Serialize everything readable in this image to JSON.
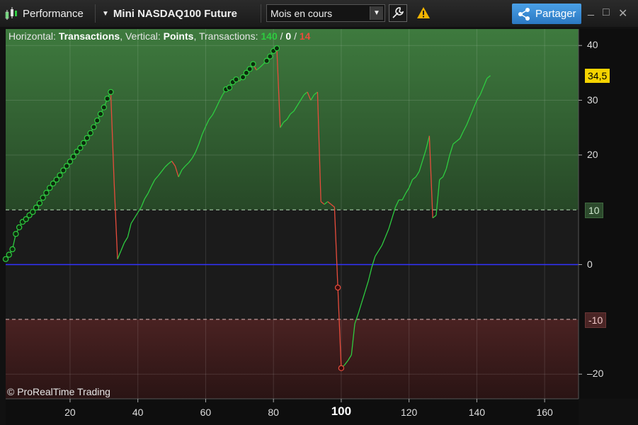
{
  "toolbar": {
    "title": "Performance",
    "instrument": "Mini NASDAQ100 Future",
    "period_select": "Mois en cours",
    "share_label": "Partager",
    "window_controls": [
      "_",
      "□",
      "✕"
    ],
    "icons": [
      "candlestick-icon",
      "dropdown-arrow-icon",
      "wrench-icon",
      "warning-icon",
      "share-icon"
    ]
  },
  "legend": {
    "h_prefix": "Horizontal: ",
    "h_value": "Transactions",
    "v_prefix": ", Vertical: ",
    "v_value": "Points",
    "t_prefix": ", Transactions: ",
    "wins": "140",
    "sep1": " / ",
    "neutral": "0",
    "sep2": " / ",
    "losses": "14"
  },
  "copyright": "© ProRealTime Trading",
  "colors": {
    "win": "#2ecc40",
    "loss": "#e74c3c",
    "zero_line": "#3333ff",
    "price_badge": "#f5d300"
  },
  "chart_data": {
    "type": "line",
    "xlabel": "",
    "ylabel": "",
    "xlim": [
      1,
      170
    ],
    "ylim": [
      -24.5,
      43
    ],
    "x_ticks": [
      20,
      40,
      60,
      80,
      100,
      120,
      140,
      160
    ],
    "x_highlight": 100,
    "y_ticks": [
      40,
      30,
      20,
      0,
      -20
    ],
    "levels": [
      {
        "value": 10,
        "label": "10"
      },
      {
        "value": -10,
        "label": "-10"
      }
    ],
    "current_value": {
      "value": 34.5,
      "label": "34,5"
    },
    "zero_line": 0,
    "grid": true,
    "series": [
      {
        "points": [
          [
            1,
            1
          ],
          [
            2,
            1.8
          ],
          [
            3,
            2.8
          ],
          [
            4,
            5.6
          ],
          [
            5,
            6.8
          ],
          [
            6,
            7.8
          ],
          [
            7,
            8.3
          ],
          [
            8,
            9.0
          ],
          [
            9,
            9.6
          ],
          [
            10,
            10.4
          ],
          [
            11,
            11.2
          ],
          [
            12,
            12.2
          ],
          [
            13,
            13.1
          ],
          [
            14,
            14.0
          ],
          [
            15,
            14.8
          ],
          [
            16,
            15.5
          ],
          [
            17,
            16.3
          ],
          [
            18,
            17.2
          ],
          [
            19,
            18.0
          ],
          [
            20,
            18.8
          ],
          [
            21,
            19.7
          ],
          [
            22,
            20.6
          ],
          [
            23,
            21.3
          ],
          [
            24,
            22.2
          ],
          [
            25,
            23.1
          ],
          [
            26,
            24.0
          ],
          [
            27,
            25.1
          ],
          [
            28,
            26.3
          ],
          [
            29,
            27.5
          ],
          [
            30,
            28.7
          ],
          [
            31,
            30.3
          ],
          [
            32,
            31.5
          ],
          [
            33,
            15.0
          ],
          [
            34,
            1.0
          ],
          [
            35,
            2.5
          ],
          [
            36,
            4.0
          ],
          [
            37,
            5.0
          ],
          [
            38,
            7.5
          ],
          [
            39,
            8.5
          ],
          [
            40,
            9.5
          ],
          [
            41,
            10.5
          ],
          [
            42,
            12.0
          ],
          [
            43,
            13.0
          ],
          [
            44,
            14.3
          ],
          [
            45,
            15.5
          ],
          [
            46,
            16.2
          ],
          [
            47,
            17.0
          ],
          [
            48,
            17.8
          ],
          [
            49,
            18.4
          ],
          [
            50,
            18.9
          ],
          [
            51,
            18.0
          ],
          [
            52,
            16.0
          ],
          [
            53,
            17.3
          ],
          [
            54,
            18.0
          ],
          [
            55,
            18.6
          ],
          [
            56,
            19.4
          ],
          [
            57,
            20.5
          ],
          [
            58,
            22.0
          ],
          [
            59,
            23.8
          ],
          [
            60,
            25.2
          ],
          [
            61,
            26.5
          ],
          [
            62,
            27.3
          ],
          [
            63,
            28.5
          ],
          [
            64,
            29.8
          ],
          [
            65,
            31.0
          ],
          [
            66,
            32.0
          ],
          [
            67,
            32.3
          ],
          [
            68,
            33.3
          ],
          [
            69,
            33.8
          ],
          [
            70,
            33.5
          ],
          [
            71,
            34.2
          ],
          [
            72,
            35.0
          ],
          [
            73,
            35.7
          ],
          [
            74,
            36.6
          ],
          [
            75,
            35.5
          ],
          [
            76,
            36.0
          ],
          [
            77,
            36.6
          ],
          [
            78,
            37.2
          ],
          [
            79,
            38.0
          ],
          [
            80,
            39.0
          ],
          [
            81,
            39.5
          ],
          [
            82,
            25.0
          ],
          [
            83,
            26.0
          ],
          [
            84,
            26.5
          ],
          [
            85,
            27.5
          ],
          [
            86,
            28.0
          ],
          [
            87,
            29.0
          ],
          [
            88,
            30.0
          ],
          [
            89,
            31.0
          ],
          [
            90,
            31.5
          ],
          [
            91,
            30.0
          ],
          [
            92,
            31.0
          ],
          [
            93,
            31.5
          ],
          [
            94,
            11.5
          ],
          [
            95,
            11.0
          ],
          [
            96,
            11.5
          ],
          [
            97,
            11.0
          ],
          [
            98,
            10.5
          ],
          [
            99,
            -4.2
          ],
          [
            100,
            -18.9
          ],
          [
            101,
            -18.3
          ],
          [
            102,
            -17.5
          ],
          [
            103,
            -16.5
          ],
          [
            104,
            -10.8
          ],
          [
            105,
            -9.0
          ],
          [
            106,
            -7.0
          ],
          [
            107,
            -5.0
          ],
          [
            108,
            -3.0
          ],
          [
            109,
            -0.5
          ],
          [
            110,
            1.5
          ],
          [
            111,
            2.5
          ],
          [
            112,
            3.5
          ],
          [
            113,
            5.0
          ],
          [
            114,
            6.5
          ],
          [
            115,
            8.5
          ],
          [
            116,
            10.5
          ],
          [
            117,
            11.8
          ],
          [
            118,
            11.8
          ],
          [
            119,
            13.0
          ],
          [
            120,
            14.0
          ],
          [
            121,
            15.5
          ],
          [
            122,
            16.0
          ],
          [
            123,
            17.0
          ],
          [
            124,
            19.0
          ],
          [
            125,
            21.0
          ],
          [
            126,
            23.5
          ],
          [
            127,
            8.5
          ],
          [
            128,
            9.0
          ],
          [
            129,
            15.5
          ],
          [
            130,
            16.0
          ],
          [
            131,
            17.5
          ],
          [
            132,
            20.0
          ],
          [
            133,
            22.0
          ],
          [
            134,
            22.5
          ],
          [
            135,
            23.0
          ],
          [
            136,
            24.3
          ],
          [
            137,
            25.5
          ],
          [
            138,
            27.0
          ],
          [
            139,
            28.5
          ],
          [
            140,
            30.0
          ],
          [
            141,
            31.0
          ],
          [
            142,
            32.5
          ],
          [
            143,
            34.0
          ],
          [
            144,
            34.5
          ]
        ]
      }
    ]
  }
}
